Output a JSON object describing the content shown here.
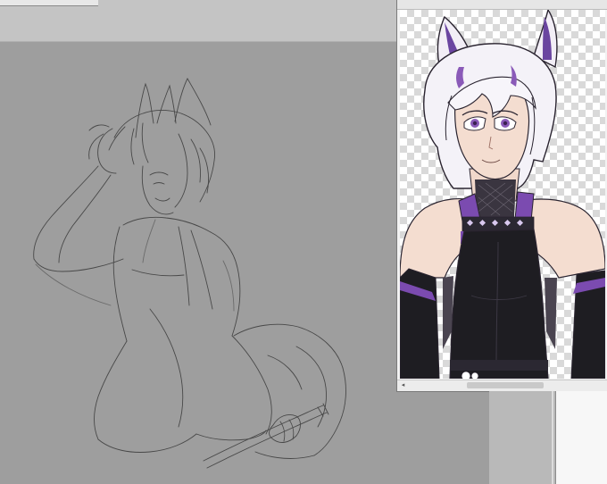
{
  "app": {
    "canvas": {
      "document_tab_label": ""
    },
    "navigator": {
      "scroll_left_glyph": "◂"
    },
    "colors": {
      "workspace_gray": "#9e9e9e",
      "toolbar_gray": "#c4c4c4",
      "sketch_line": "#3a3a3a",
      "outfit_black": "#1e1d22",
      "accent_purple": "#7b4bb0",
      "hair_white": "#f4f2f8",
      "skin": "#f4ddd0",
      "eye_violet": "#8a5ab8"
    }
  }
}
